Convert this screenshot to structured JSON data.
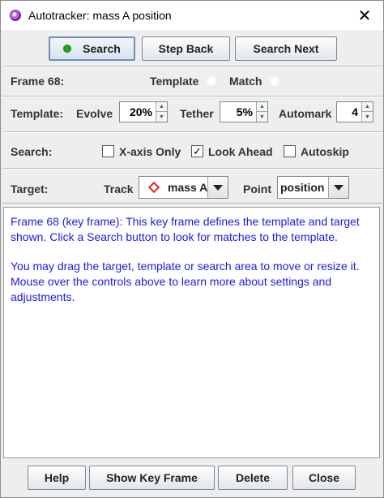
{
  "window": {
    "title": "Autotracker: mass A position",
    "close_glyph": "✕"
  },
  "toolbar": {
    "search_label": "Search",
    "step_back_label": "Step Back",
    "search_next_label": "Search Next"
  },
  "status": {
    "frame_label": "Frame 68:",
    "template_label": "Template",
    "match_label": "Match"
  },
  "template_row": {
    "label": "Template:",
    "evolve_label": "Evolve",
    "evolve_value": "20%",
    "tether_label": "Tether",
    "tether_value": "5%",
    "automark_label": "Automark",
    "automark_value": "4"
  },
  "search_row": {
    "label": "Search:",
    "x_axis_only": {
      "label": "X-axis Only",
      "checked": false
    },
    "look_ahead": {
      "label": "Look Ahead",
      "checked": true
    },
    "autoskip": {
      "label": "Autoskip",
      "checked": false
    }
  },
  "target_row": {
    "label": "Target:",
    "track_label": "Track",
    "track_value": "mass A",
    "point_label": "Point",
    "point_value": "position"
  },
  "info": {
    "paragraph1": "Frame 68 (key frame): This key frame defines the template and target shown. Click a Search button to look for matches to the template.",
    "paragraph2": "You may drag the target, template or search area to move or resize it. Mouse over the controls above to learn more about settings and adjustments."
  },
  "footer": {
    "help_label": "Help",
    "show_key_frame_label": "Show Key Frame",
    "delete_label": "Delete",
    "close_label": "Close"
  },
  "colors": {
    "info_text": "#1a1ae6",
    "search_indicator": "#1ea51e",
    "track_marker": "#e0242a"
  },
  "icons": {
    "app": "autotracker-icon",
    "search_indicator": "green-dot-icon",
    "track_marker": "red-diamond-icon",
    "dropdown": "chevron-down-icon"
  }
}
